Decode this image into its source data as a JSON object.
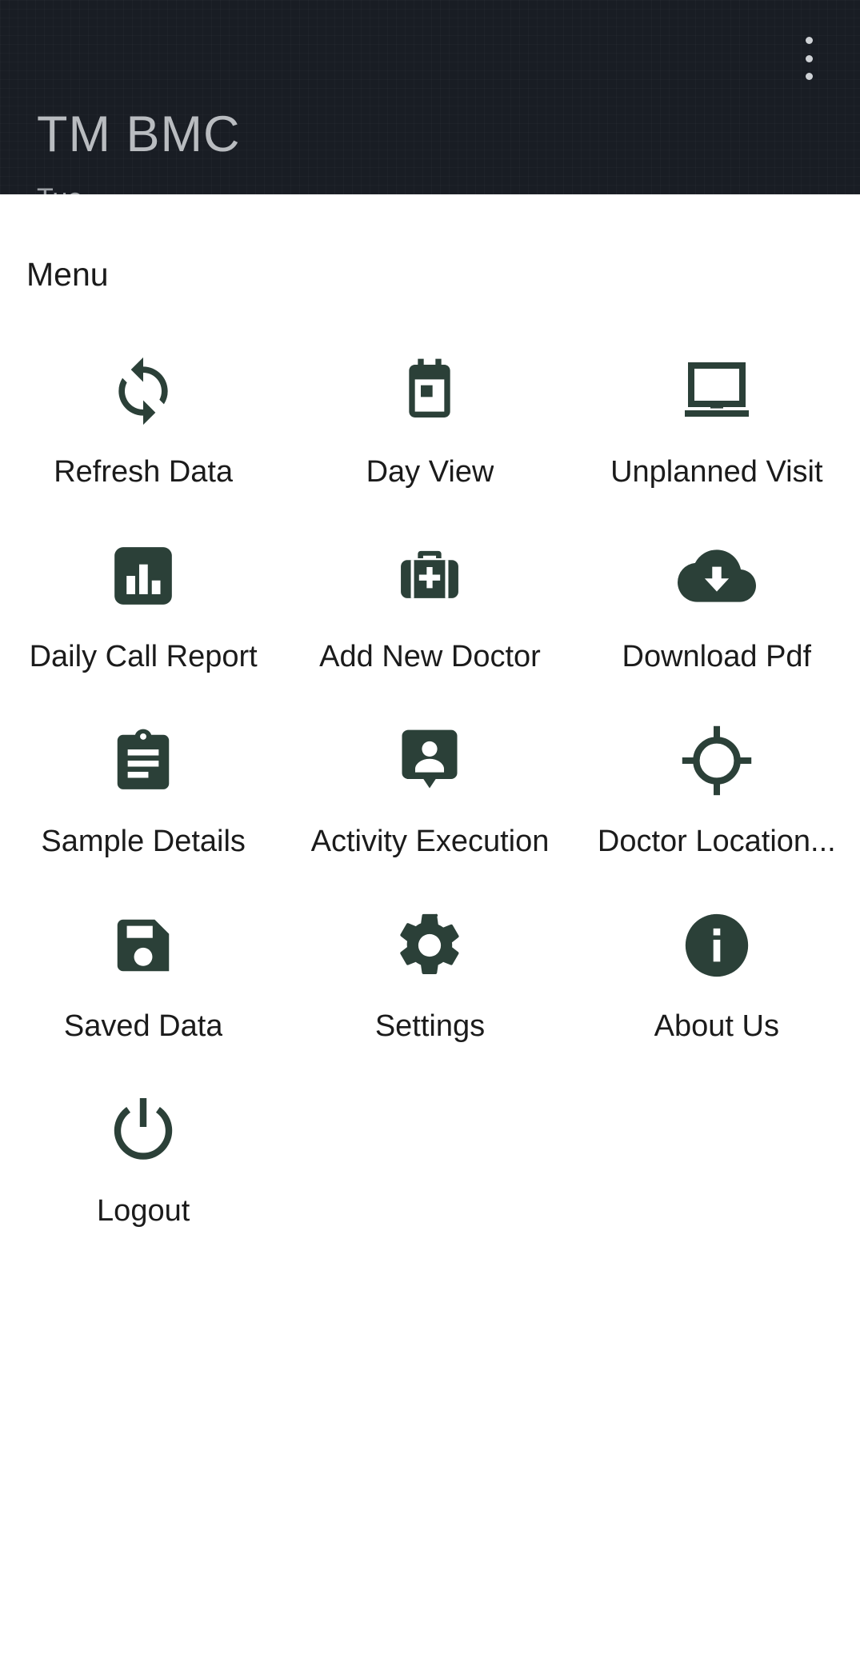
{
  "appbar": {
    "title": "TM  BMC",
    "subtitle": "Tue",
    "overflow_icon": "more-vert-icon"
  },
  "colors": {
    "appbar_background": "#191d24",
    "appbar_title": "#b9bcc0",
    "icon": "#2b4038",
    "page_background": "#ffffff",
    "label_text": "#1b1b1b"
  },
  "main": {
    "heading": "Menu",
    "items": [
      {
        "label": "Refresh Data",
        "icon": "refresh-icon"
      },
      {
        "label": "Day View",
        "icon": "calendar-icon"
      },
      {
        "label": "Unplanned Visit",
        "icon": "laptop-icon"
      },
      {
        "label": "Daily Call Report",
        "icon": "bar-chart-icon"
      },
      {
        "label": "Add New Doctor",
        "icon": "medical-bag-icon"
      },
      {
        "label": "Download Pdf",
        "icon": "cloud-download-icon"
      },
      {
        "label": "Sample Details",
        "icon": "clipboard-icon"
      },
      {
        "label": "Activity Execution",
        "icon": "person-pin-icon"
      },
      {
        "label": "Doctor Location...",
        "icon": "gps-crosshair-icon"
      },
      {
        "label": "Saved Data",
        "icon": "floppy-disk-icon"
      },
      {
        "label": "Settings",
        "icon": "gear-icon"
      },
      {
        "label": "About Us",
        "icon": "info-circle-icon"
      },
      {
        "label": "Logout",
        "icon": "power-icon"
      }
    ]
  }
}
